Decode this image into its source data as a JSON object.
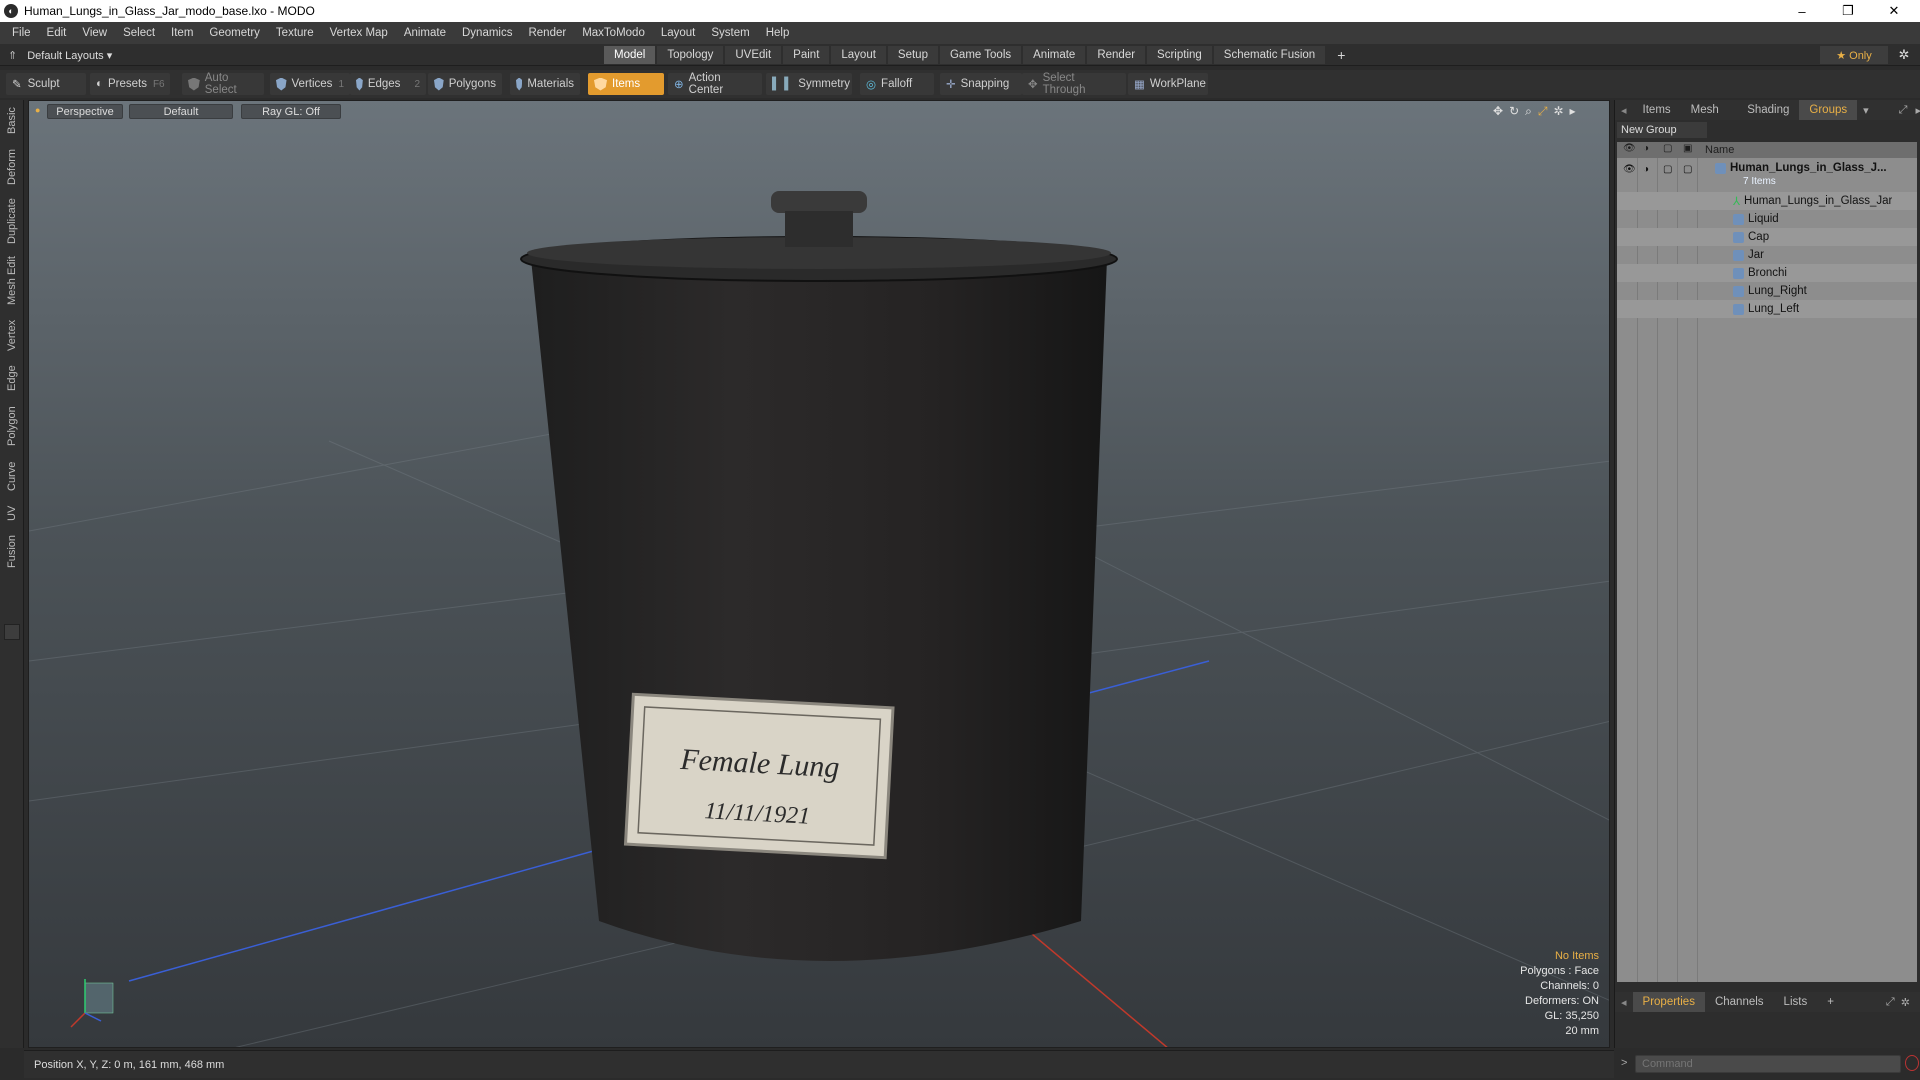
{
  "window": {
    "title": "Human_Lungs_in_Glass_Jar_modo_base.lxo - MODO",
    "minimize": "–",
    "restore": "❐",
    "close": "✕"
  },
  "menu": [
    "File",
    "Edit",
    "View",
    "Select",
    "Item",
    "Geometry",
    "Texture",
    "Vertex Map",
    "Animate",
    "Dynamics",
    "Render",
    "MaxToModo",
    "Layout",
    "System",
    "Help"
  ],
  "layoutbar": {
    "layout_select": "Default Layouts ▾",
    "tabs": [
      "Model",
      "Topology",
      "UVEdit",
      "Paint",
      "Layout",
      "Setup",
      "Game Tools",
      "Animate",
      "Render",
      "Scripting",
      "Schematic Fusion"
    ],
    "active_tab": "Model",
    "add": "+",
    "only": "★  Only",
    "gear": "✲"
  },
  "toolbar": {
    "sculpt": "Sculpt",
    "presets": "Presets",
    "presets_key": "F6",
    "auto_select": "Auto Select",
    "vertices": "Vertices",
    "vertices_key": "1",
    "edges": "Edges",
    "edges_key": "2",
    "polygons": "Polygons",
    "materials": "Materials",
    "items": "Items",
    "action_center": "Action Center",
    "symmetry": "Symmetry",
    "falloff": "Falloff",
    "snapping": "Snapping",
    "select_through": "Select Through",
    "workplane": "WorkPlane"
  },
  "left_tabs": [
    "Basic",
    "Deform",
    "Duplicate",
    "Mesh Edit",
    "Vertex",
    "Edge",
    "Polygon",
    "Curve",
    "UV",
    "Fusion"
  ],
  "viewport": {
    "view": "Perspective",
    "shading": "Default",
    "raygl": "Ray GL: Off",
    "label_line1": "Female Lung",
    "label_line2": "11/11/1921",
    "stats": {
      "no_items": "No Items",
      "polygons": "Polygons : Face",
      "channels": "Channels: 0",
      "deformers": "Deformers: ON",
      "gl": "GL: 35,250",
      "unit": "20 mm"
    }
  },
  "status": {
    "position": "Position X, Y, Z:  0 m, 161 mm, 468 mm"
  },
  "right_panel": {
    "tabs": [
      "Items",
      "Mesh ...",
      "Shading",
      "Groups"
    ],
    "active_tab": "Groups",
    "new_group": "New Group",
    "name_col": "Name",
    "group": "Human_Lungs_in_Glass_J...",
    "group_count": "7 Items",
    "items": [
      "Human_Lungs_in_Glass_Jar",
      "Liquid",
      "Cap",
      "Jar",
      "Bronchi",
      "Lung_Right",
      "Lung_Left"
    ],
    "bottom_tabs": [
      "Properties",
      "Channels",
      "Lists"
    ],
    "bottom_active": "Properties",
    "bottom_add": "+",
    "command_placeholder": "Command"
  },
  "colors": {
    "accent": "#e39b2e",
    "highlight_text": "#e9b046"
  }
}
